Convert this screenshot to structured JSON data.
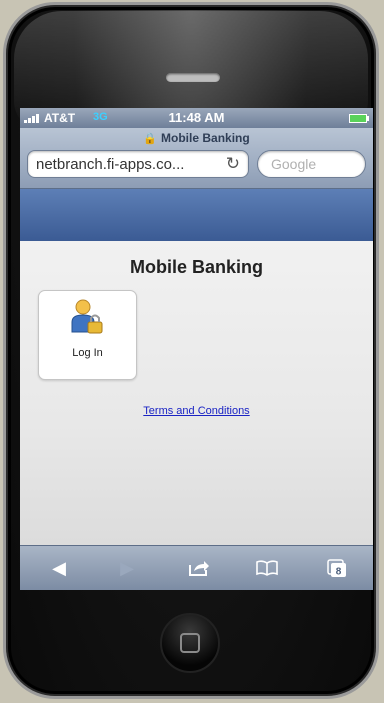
{
  "status_bar": {
    "carrier": "AT&T",
    "network": "3G",
    "time": "11:48 AM"
  },
  "browser": {
    "page_title": "Mobile Banking",
    "url": "netbranch.fi-apps.co...",
    "search_placeholder": "Google"
  },
  "page": {
    "title": "Mobile Banking",
    "login_label": "Log In",
    "terms_link": "Terms and Conditions"
  },
  "toolbar": {
    "tabs_count": "8"
  }
}
